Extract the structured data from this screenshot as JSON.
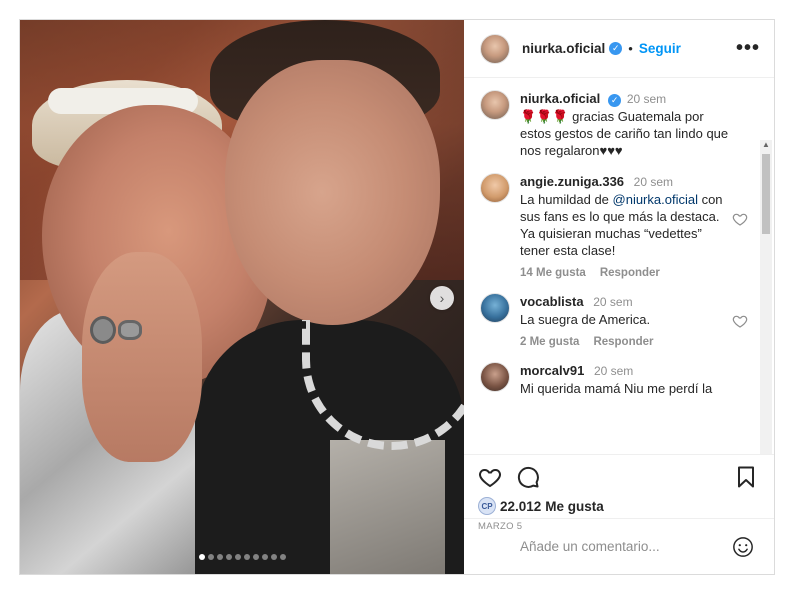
{
  "header": {
    "username": "niurka.oficial",
    "separator": "•",
    "follow_label": "Seguir",
    "more_label": "•••"
  },
  "caption": {
    "username": "niurka.oficial",
    "time": "20 sem",
    "emojis": "🌹🌹🌹",
    "text": " gracias Guatemala por estos gestos de cariño tan lindo que nos regalaron♥♥♥"
  },
  "comments": [
    {
      "username": "angie.zuniga.336",
      "time": "20 sem",
      "text_before": "La humildad de ",
      "mention": "@niurka.oficial",
      "text_after": " con sus fans es lo que más la destaca. Ya quisieran muchas “vedettes” tener esta clase!",
      "likes": "14 Me gusta",
      "reply": "Responder"
    },
    {
      "username": "vocablista",
      "time": "20 sem",
      "text": "La suegra de America.",
      "likes": "2 Me gusta",
      "reply": "Responder"
    },
    {
      "username": "morcalv91",
      "time": "20 sem",
      "text": "Mi querida mamá Niu me perdí la"
    }
  ],
  "actions": {
    "likes_badge": "CP",
    "likes_count": "22.012",
    "likes_label": "Me gusta",
    "date": "MARZO 5"
  },
  "add_comment": {
    "placeholder": "Añade un comentario..."
  },
  "carousel": {
    "total_slides": 10,
    "active_index": 0,
    "next_arrow": "›"
  },
  "colors": {
    "accent": "#0095f6",
    "verified": "#3897f0",
    "muted": "#8e8e8e"
  }
}
